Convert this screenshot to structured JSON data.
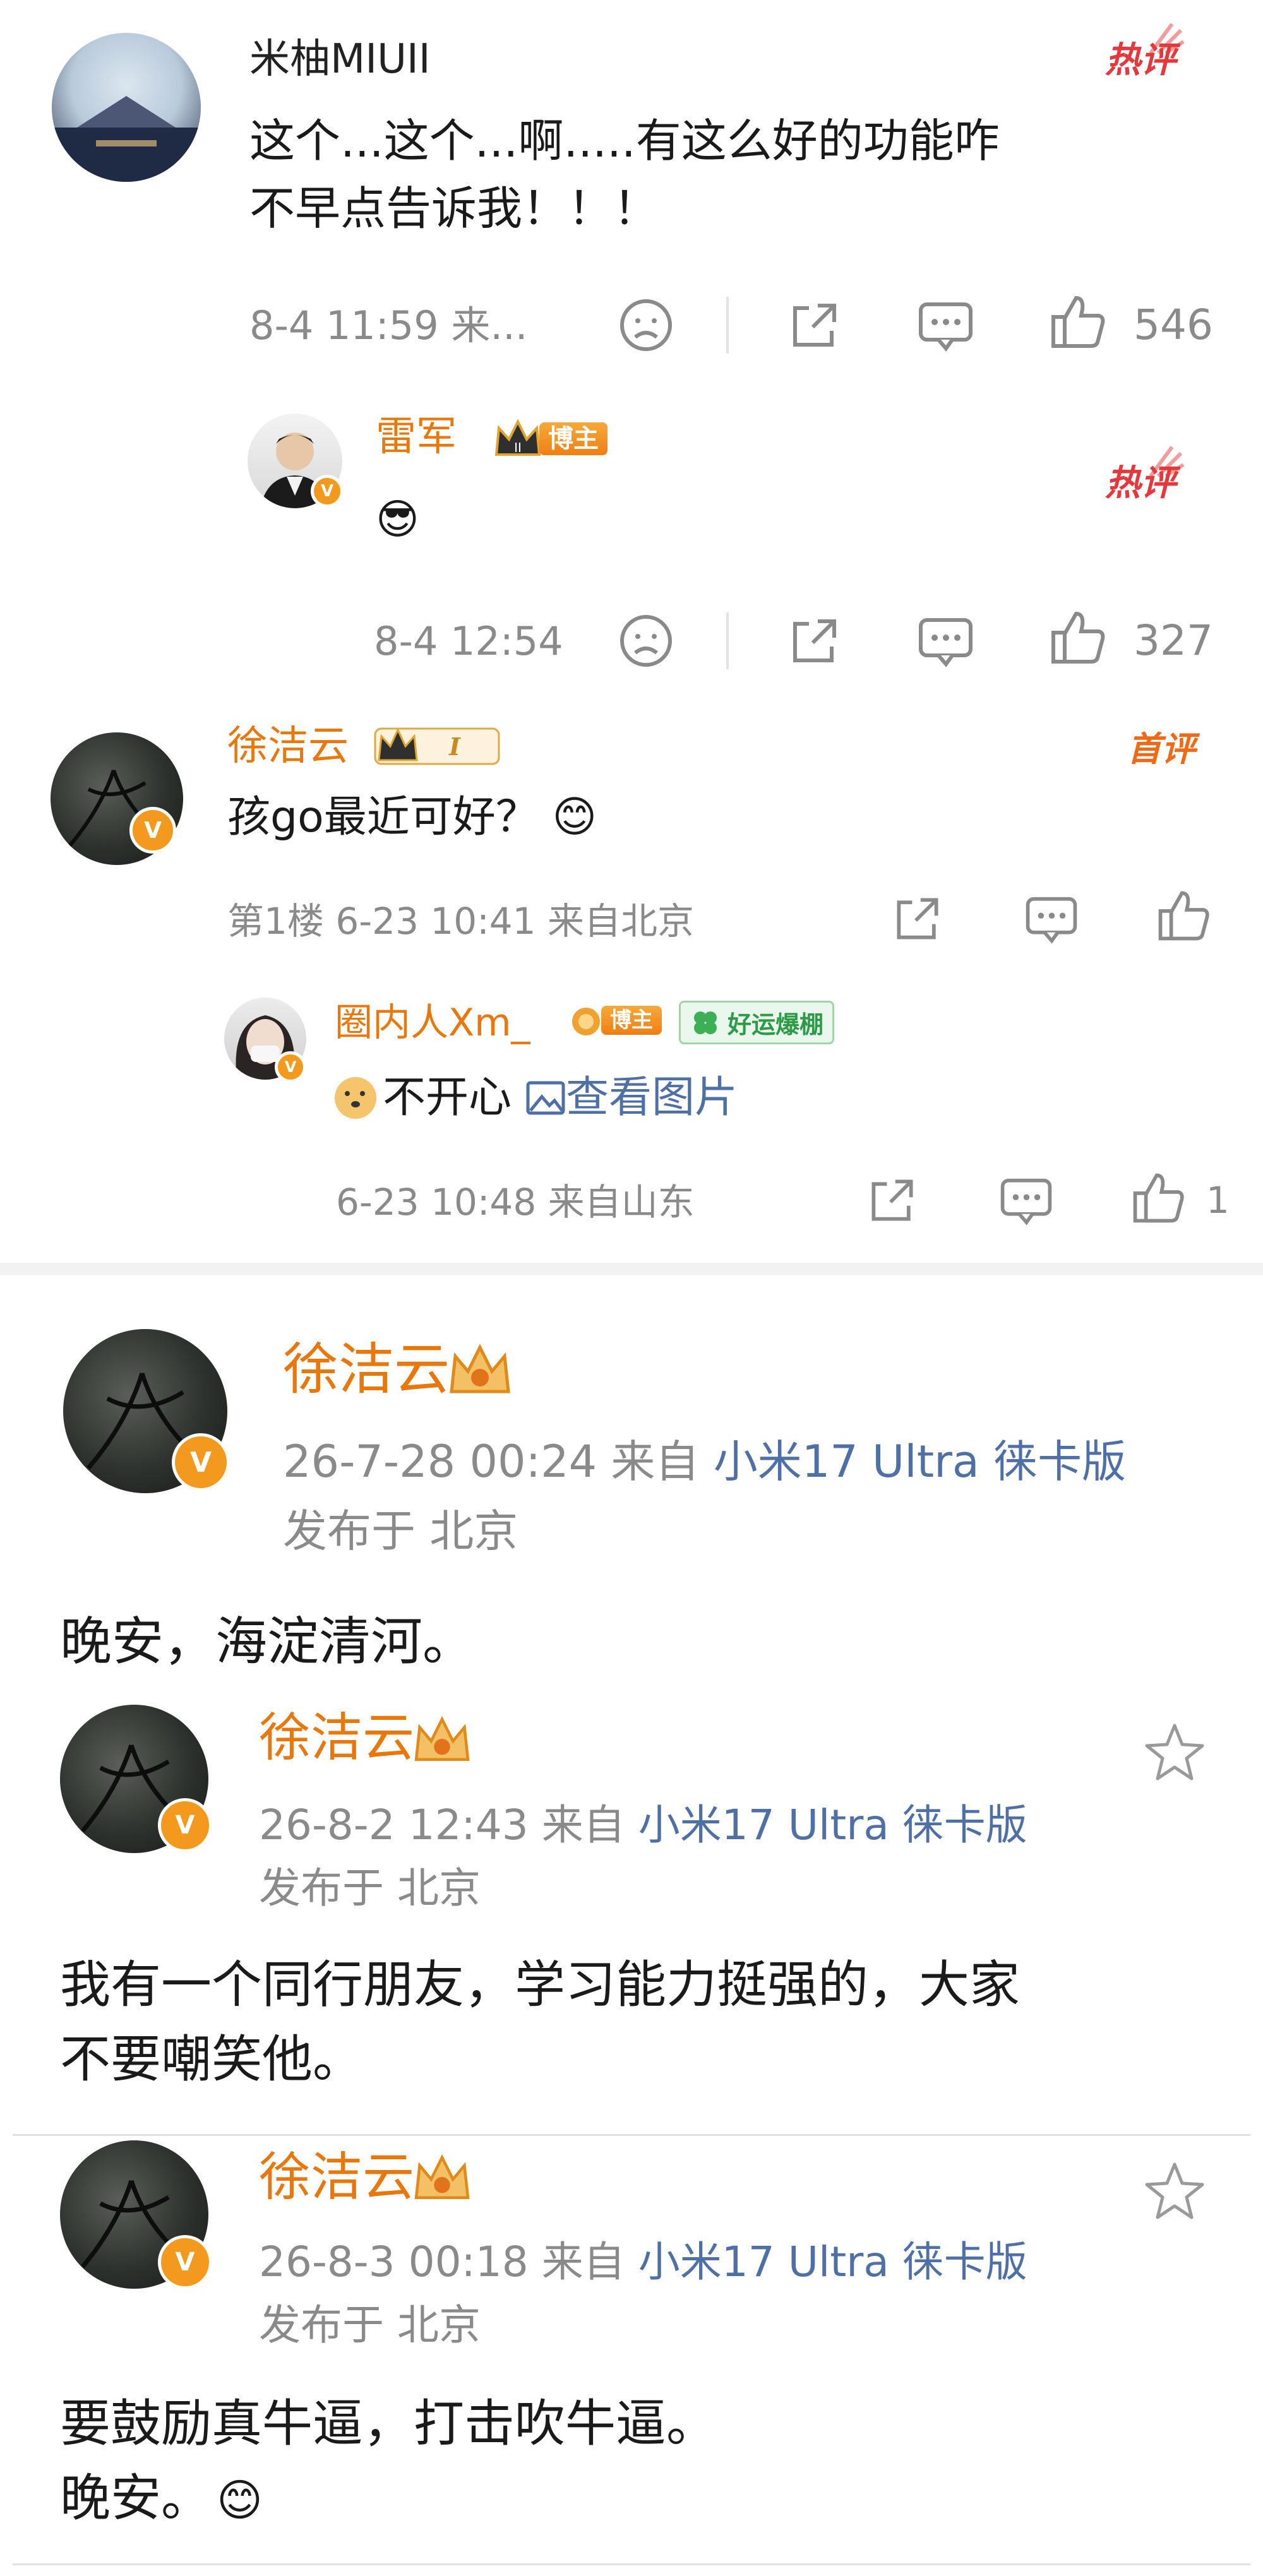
{
  "thread1": {
    "comment": {
      "author": "米柚MIUII",
      "hot_label": "热评",
      "text_line1": "这个...这个...啊.....有这么好的功能咋",
      "text_line2": "不早点告诉我！！！",
      "time": "8-4 11:59 来...",
      "likes": "546"
    },
    "reply": {
      "author": "雷军",
      "badge_rank": "II",
      "badge_tag": "博主",
      "hot_label": "热评",
      "emoji": "😎",
      "time": "8-4 12:54",
      "likes": "327"
    }
  },
  "thread2": {
    "comment": {
      "author": "徐洁云",
      "badge_rank": "I",
      "first_label": "首评",
      "text": "孩go最近可好？",
      "emoji": "😊",
      "meta": "第1楼 6-23 10:41 来自北京"
    },
    "reply": {
      "author": "圈内人Xm_",
      "badge_tag": "博主",
      "extra_badge": "好运爆棚",
      "text": "不开心",
      "link": "查看图片",
      "meta": "6-23 10:48 来自山东",
      "likes": "1"
    }
  },
  "posts": [
    {
      "author": "徐洁云",
      "meta_time": "26-7-28 00:24 来自",
      "device": "小米17 Ultra 徕卡版",
      "location": "发布于 北京",
      "text_line1": "晚安，海淀清河。",
      "text_line2": ""
    },
    {
      "author": "徐洁云",
      "meta_time": "26-8-2 12:43 来自",
      "device": "小米17 Ultra 徕卡版",
      "location": "发布于 北京",
      "text_line1": "我有一个同行朋友，学习能力挺强的，大家",
      "text_line2": "不要嘲笑他。"
    },
    {
      "author": "徐洁云",
      "meta_time": "26-8-3 00:18 来自",
      "device": "小米17 Ultra 徕卡版",
      "location": "发布于 北京",
      "text_line1": "要鼓励真牛逼，打击吹牛逼。",
      "text_line2": "晚安。",
      "emoji": "😊"
    }
  ],
  "colors": {
    "hot_red": "#e4393c",
    "name_orange": "#e8770c",
    "meta_gray": "#8a8a8a",
    "device_blue": "#4f6fa7",
    "badge_orange": "#f39a1e"
  }
}
